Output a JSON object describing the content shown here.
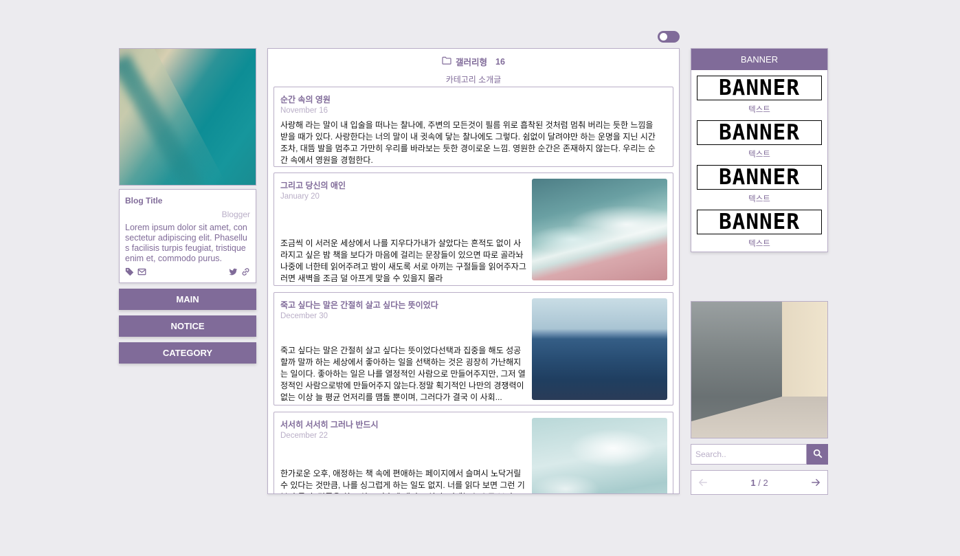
{
  "theme_toggle": {
    "state": "off"
  },
  "profile": {
    "blog_title": "Blog Title",
    "blogger": "Blogger",
    "description": "Lorem ipsum dolor sit amet, consectetur adipiscing elit. Phasellus facilisis turpis feugiat, tristique enim et, commodo purus.",
    "icons": [
      "tag-icon",
      "mail-icon",
      "twitter-icon",
      "link-icon"
    ]
  },
  "nav": {
    "main": "MAIN",
    "notice": "NOTICE",
    "category": "CATEGORY"
  },
  "category": {
    "name": "갤러리형",
    "count": "16",
    "intro": "카테고리 소개글"
  },
  "posts": [
    {
      "title": "순간 속의 영원",
      "date": "November 16",
      "text": "사랑해 라는 말이 내 입술을 떠나는 찰나에, 주변의 모든것이 필름 위로 흡착된 것처럼 멈춰 버리는 듯한 느낌을 받을 때가 있다. 사랑한다는 너의 말이 내 귓속에 닿는 찰나에도 그렇다. 쉼없이 달려야만 하는 운명을 지닌 시간조차, 대뜸 발을 멈추고 가만히 우리를 바라보는 듯한 경이로운 느낌. 영원한 순간은 존재하지 않는다. 우리는 순간 속에서 영원을 경험한다."
    },
    {
      "title": "그리고 당신의 애인",
      "date": "January 20",
      "text": "조금씩 이 서러운 세상에서 나를 지우다가내가 살았다는 흔적도 없이 사라지고 싶은 밤 책을 보다가 마음에 걸리는 문장들이 있으면 따로 골라놔나중에 너한테 읽어주려고 밤이 새도록 서로 아끼는 구절들을 읽어주자그러면 새벽을 조금 덜 아프게 맞을 수 있을지 몰라"
    },
    {
      "title": "죽고 싶다는 말은 간절히 살고 싶다는 뜻이었다",
      "date": "December 30",
      "text": "죽고 싶다는 말은 간절히 살고 싶다는 뜻이었다선택과 집중을 해도 성공할까 말까 하는 세상에서 좋아하는 일을 선택하는 것은 굉장히 가난해지는 일이다. 좋아하는 일은 나를 열정적인 사람으로 만들어주지만, 그저 열정적인 사람으로밖에 만들어주지 않는다.정말 획기적인 나만의 경쟁력이 없는 이상 늘 평균 언저리를 맴돌 뿐이며, 그러다가 결국 이 사회..."
    },
    {
      "title": "서서히 서서히 그러나 반드시",
      "date": "December 22",
      "text": "한가로운 오후, 애정하는 책 속에 편애하는 페이지에서 슬며시 노닥거릴 수 있다는 것만큼, 나를 싱그럽게 하는 일도 없지. 너를 읽다 보면 그런 기분이 들어. 밑줄을 치고 싶고 가슴에 새기고 싶어. 이제는 눈으로 보지"
    }
  ],
  "banner": {
    "header": "BANNER",
    "items": [
      {
        "image_text": "BANNER",
        "label": "텍스트"
      },
      {
        "image_text": "BANNER",
        "label": "텍스트"
      },
      {
        "image_text": "BANNER",
        "label": "텍스트"
      },
      {
        "image_text": "BANNER",
        "label": "텍스트"
      }
    ]
  },
  "search": {
    "placeholder": "Search.."
  },
  "pager": {
    "current": "1",
    "total": "2",
    "separator": "/"
  },
  "colors": {
    "accent": "#806b99",
    "border": "#b9aec7",
    "background": "#ecebef"
  }
}
